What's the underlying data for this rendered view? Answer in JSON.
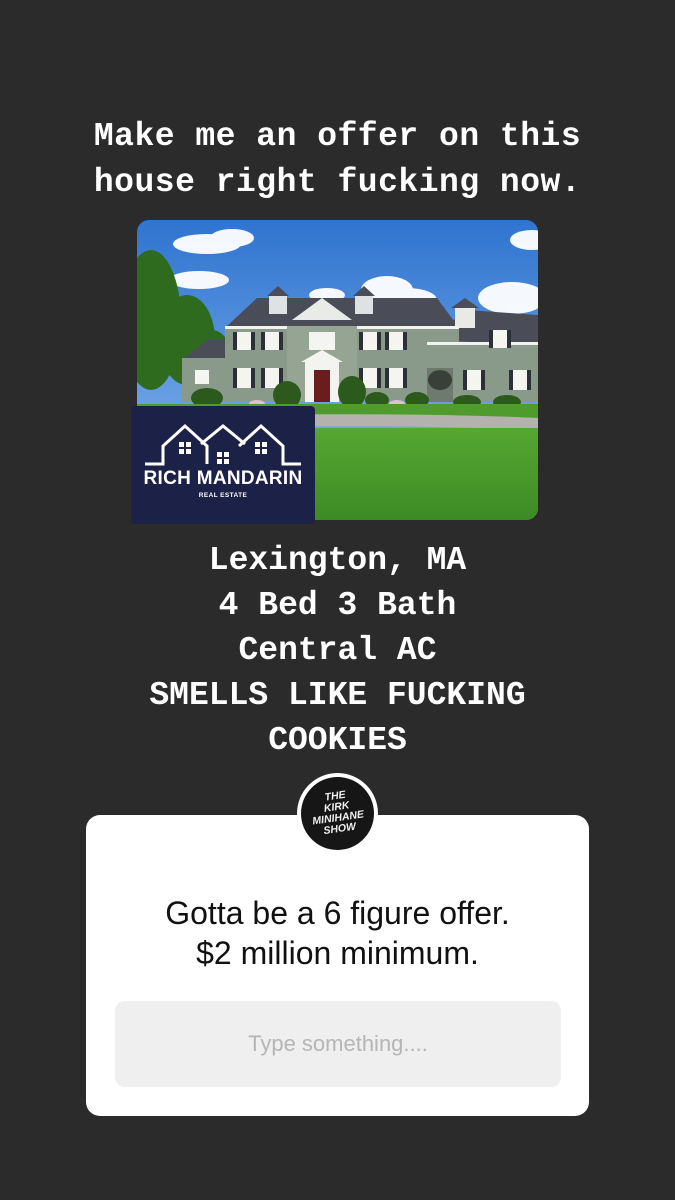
{
  "headline": {
    "line1": "Make me an offer on this",
    "line2": "house right fucking now."
  },
  "listing_photo": {
    "logo": {
      "name": "RICH MANDARIN",
      "subtitle": "REAL ESTATE",
      "bg_color": "#1c2148"
    }
  },
  "details": {
    "line1": "Lexington, MA",
    "line2": "4 Bed 3 Bath",
    "line3": "Central AC",
    "line4": "SMELLS LIKE FUCKING",
    "line5": "COOKIES"
  },
  "question_sticker": {
    "avatar": {
      "line1": "THE",
      "line2": "KIRK",
      "line3": "MINIHANE",
      "line4": "SHOW"
    },
    "question_line1": "Gotta be a 6 figure offer.",
    "question_line2": "$2 million minimum.",
    "input_placeholder": "Type something...."
  },
  "colors": {
    "background": "#2b2b2b",
    "card": "#ffffff",
    "input_bg": "#efefef"
  }
}
